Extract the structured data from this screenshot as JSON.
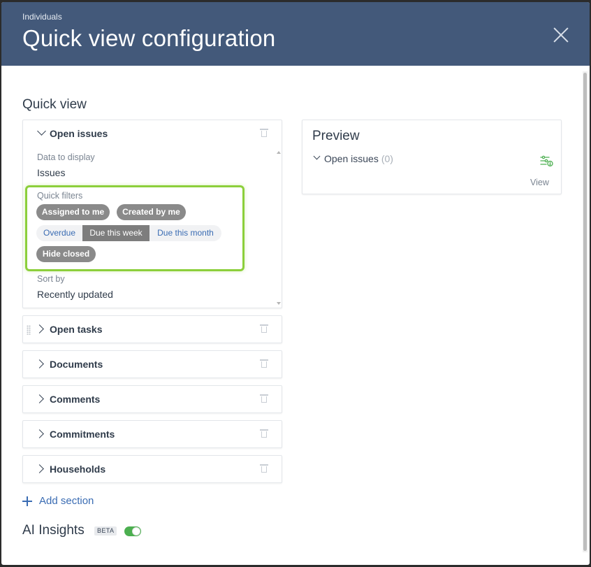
{
  "header": {
    "breadcrumb": "Individuals",
    "title": "Quick view configuration"
  },
  "quick_view": {
    "heading": "Quick view",
    "sections": [
      {
        "title": "Open issues",
        "expanded": true,
        "data_to_display_label": "Data to display",
        "data_to_display_value": "Issues",
        "quick_filters_label": "Quick filters",
        "filters": {
          "assigned_to_me": "Assigned to me",
          "created_by_me": "Created by me",
          "overdue": "Overdue",
          "due_this_week": "Due this week",
          "due_this_month": "Due this month",
          "hide_closed": "Hide closed"
        },
        "selected_due_filter": "Due this week",
        "sort_by_label": "Sort by",
        "sort_by_value": "Recently updated"
      },
      {
        "title": "Open tasks",
        "expanded": false
      },
      {
        "title": "Documents",
        "expanded": false
      },
      {
        "title": "Comments",
        "expanded": false
      },
      {
        "title": "Commitments",
        "expanded": false
      },
      {
        "title": "Households",
        "expanded": false
      }
    ],
    "add_section_label": "Add section"
  },
  "preview": {
    "title": "Preview",
    "item_label": "Open issues",
    "item_count": "(0)",
    "view_label": "View"
  },
  "ai_insights": {
    "title": "AI Insights",
    "badge": "BETA",
    "enabled": true
  },
  "colors": {
    "header_bg": "#43597a",
    "highlight_green": "#8ccf3b",
    "link_blue": "#3a6cb3",
    "toggle_on": "#4caf50",
    "chip_gray": "#8a8a8a"
  }
}
